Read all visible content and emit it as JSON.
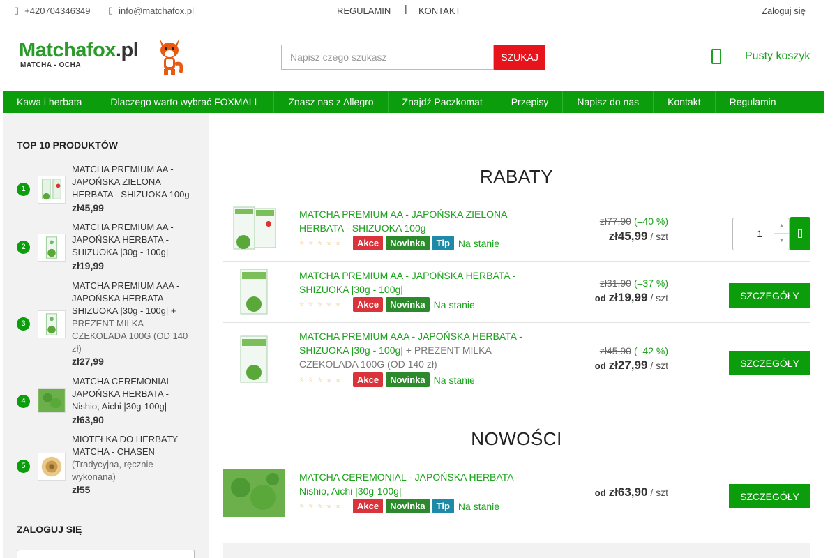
{
  "topbar": {
    "phone": "+420704346349",
    "email": "info@matchafox.pl",
    "links": [
      "REGULAMIN",
      "KONTAKT"
    ],
    "separator": "|",
    "login": "Zaloguj się"
  },
  "logo": {
    "main": "Matchafox",
    "suffix": ".pl",
    "sub": "MATCHA - OCHA"
  },
  "search": {
    "placeholder": "Napisz czego szukasz",
    "button": "SZUKAJ"
  },
  "cart": {
    "label": "Pusty koszyk",
    "icon": "phone-cart-icon"
  },
  "nav": [
    "Kawa i herbata",
    "Dlaczego warto wybrać FOXMALL",
    "Znasz nas z Allegro",
    "Znajdź Paczkomat",
    "Przepisy",
    "Napisz do nas",
    "Kontakt",
    "Regulamin"
  ],
  "sidebar": {
    "top_title": "TOP 10 PRODUKTÓW",
    "top_items": [
      {
        "num": "1",
        "name": "MATCHA PREMIUM AA - JAPOŃSKA ZIELONA HERBATA - SHIZUOKA 100g",
        "extra": "",
        "price": "zł45,99"
      },
      {
        "num": "2",
        "name": "MATCHA PREMIUM AA - JAPOŃSKA HERBATA - SHIZUOKA |30g - 100g|",
        "extra": "",
        "price": "zł19,99"
      },
      {
        "num": "3",
        "name": "MATCHA PREMIUM AAA - JAPOŃSKA HERBATA - SHIZUOKA |30g - 100g| +",
        "extra": "PREZENT MILKA CZEKOLADA 100G (OD 140 zł)",
        "price": "zł27,99"
      },
      {
        "num": "4",
        "name": "MATCHA CEREMONIAL - JAPOŃSKA HERBATA - Nishio, Aichi |30g-100g|",
        "extra": "",
        "price": "zł63,90"
      },
      {
        "num": "5",
        "name": "MIOTEŁKA DO HERBATY MATCHA - CHASEN",
        "extra": "(Tradycyjna, ręcznie wykonana)",
        "price": "zł55"
      }
    ],
    "login_title": "ZALOGUJ SIĘ"
  },
  "sections": {
    "rabaty": "RABATY",
    "nowosci": "NOWOŚCI"
  },
  "badges": {
    "akce": "Akce",
    "novinka": "Novinka",
    "tip": "Tip",
    "stock": "Na stanie",
    "od": "od",
    "unit": "/ szt",
    "details": "SZCZEGÓŁY"
  },
  "products": [
    {
      "title": "MATCHA PREMIUM AA - JAPOŃSKA ZIELONA HERBATA - SHIZUOKA 100g",
      "extra": "",
      "old": "zł77,90",
      "disc": "(–40 %)",
      "price": "zł45,99",
      "qty": "1"
    },
    {
      "title": "MATCHA PREMIUM AA - JAPOŃSKA HERBATA - SHIZUOKA |30g - 100g|",
      "extra": "",
      "old": "zł31,90",
      "disc": "(–37 %)",
      "price": "zł19,99"
    },
    {
      "title": "MATCHA PREMIUM AAA - JAPOŃSKA HERBATA - SHIZUOKA |30g - 100g|",
      "extra": " + PREZENT MILKA CZEKOLADA 100G (OD 140 zł)",
      "old": "zł45,90",
      "disc": "(–42 %)",
      "price": "zł27,99"
    },
    {
      "title": "MATCHA CEREMONIAL - JAPOŃSKA HERBATA - Nishio, Aichi |30g-100g|",
      "extra": "",
      "price": "zł63,90"
    }
  ],
  "colors": {
    "brand_green": "#0c9d0c",
    "search_red": "#e8141b",
    "akce": "#d9343b",
    "novinka": "#2c8a2c",
    "tip": "#1e8aa8"
  }
}
